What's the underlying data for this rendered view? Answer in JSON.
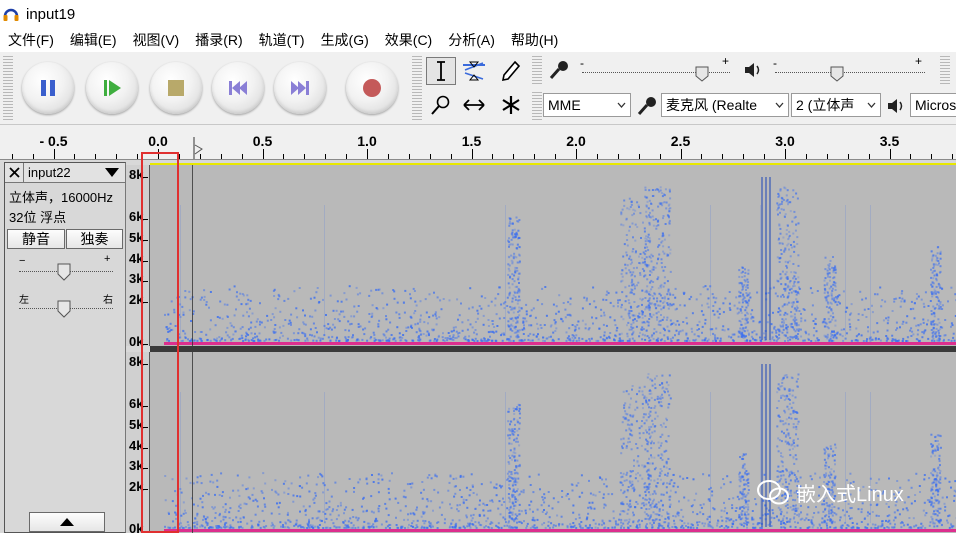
{
  "window": {
    "title": "input19"
  },
  "menu": [
    {
      "label": "文件(F)",
      "name": "menu-file"
    },
    {
      "label": "编辑(E)",
      "name": "menu-edit"
    },
    {
      "label": "视图(V)",
      "name": "menu-view"
    },
    {
      "label": "播录(R)",
      "name": "menu-transport"
    },
    {
      "label": "轨道(T)",
      "name": "menu-tracks"
    },
    {
      "label": "生成(G)",
      "name": "menu-generate"
    },
    {
      "label": "效果(C)",
      "name": "menu-effect"
    },
    {
      "label": "分析(A)",
      "name": "menu-analyze"
    },
    {
      "label": "帮助(H)",
      "name": "menu-help"
    }
  ],
  "transport": {
    "buttons": [
      {
        "name": "pause-button",
        "icon": "pause-icon",
        "color": "#3a5fcd"
      },
      {
        "name": "play-button",
        "icon": "play-icon",
        "color": "#3fae3f"
      },
      {
        "name": "stop-button",
        "icon": "stop-icon",
        "color": "#b8a96a"
      },
      {
        "name": "skip-to-start-button",
        "icon": "skip-start-icon",
        "color": "#8a7fd6"
      },
      {
        "name": "skip-to-end-button",
        "icon": "skip-end-icon",
        "color": "#8a7fd6"
      },
      {
        "name": "record-button",
        "icon": "record-icon",
        "color": "#c45a5a"
      }
    ]
  },
  "tools": [
    "selection-tool",
    "envelope-tool",
    "draw-tool",
    "zoom-tool",
    "timeshift-tool",
    "multi-tool"
  ],
  "meters": {
    "record_minus": "-",
    "record_plus": "+",
    "play_minus": "-",
    "play_plus": "+"
  },
  "device": {
    "host": "MME",
    "input_device": "麦克风 (Realte",
    "input_channels": "2 (立体声",
    "output_device": "Micros"
  },
  "ruler": {
    "labels": [
      "- 0.5",
      "0.0",
      "0.5",
      "1.0",
      "1.5",
      "2.0",
      "2.5",
      "3.0",
      "3.5"
    ],
    "values": [
      -0.5,
      0.0,
      0.5,
      1.0,
      1.5,
      2.0,
      2.5,
      3.0,
      3.5
    ]
  },
  "track": {
    "name": "input22",
    "info_line1": "立体声，16000Hz",
    "info_line2": "32位 浮点",
    "mute_label": "静音",
    "solo_label": "独奏",
    "gain_minus": "−",
    "gain_plus": "+",
    "pan_left": "左",
    "pan_right": "右",
    "freq_labels": [
      "8k",
      "6k",
      "5k",
      "4k",
      "3k",
      "2k",
      "0k"
    ],
    "freq_values": [
      8,
      6,
      5,
      4,
      3,
      2,
      0
    ]
  },
  "watermark": {
    "text": "嵌入式Linux"
  },
  "colors": {
    "spectrogram_bg": "#b9b9b9",
    "spectrogram_energy": "#3b6ff0",
    "peak": "#e0208a",
    "selection_box": "#e03030",
    "track_border": "#e8e800"
  }
}
